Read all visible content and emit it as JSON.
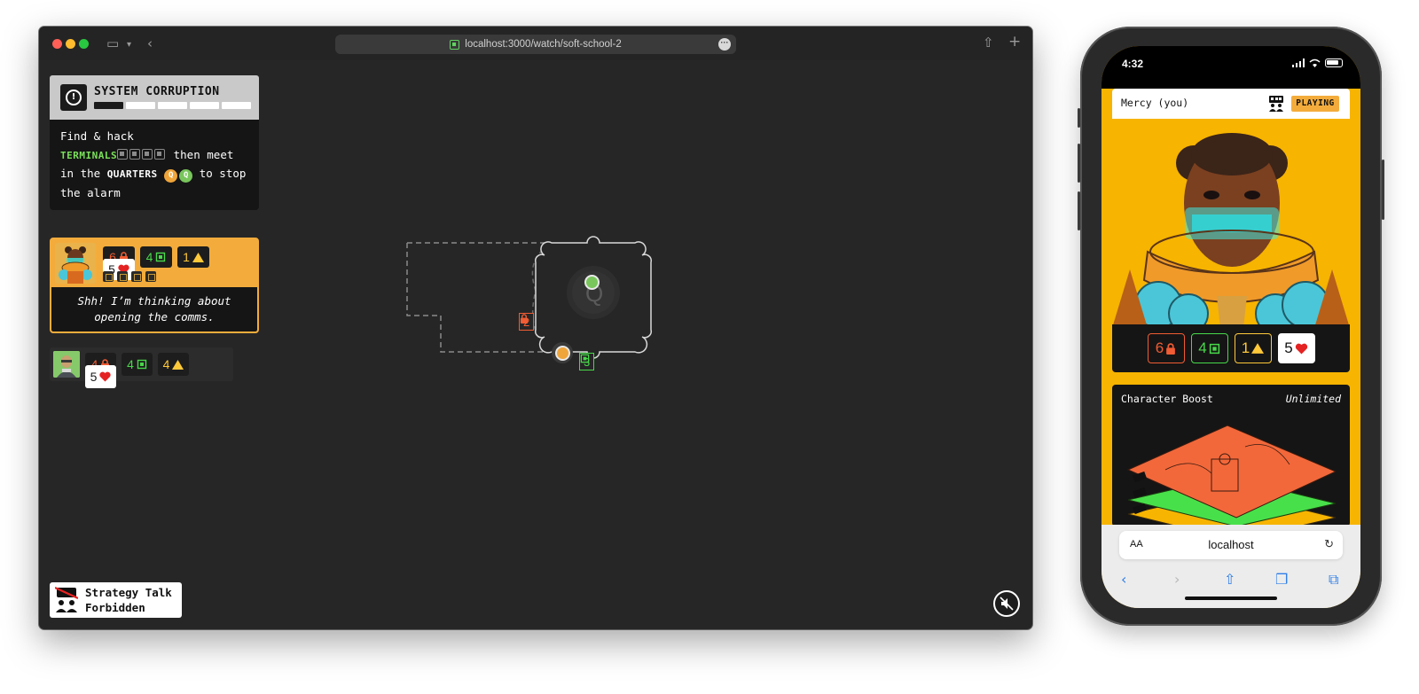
{
  "browser": {
    "url": "localhost:3000/watch/soft-school-2"
  },
  "corruption": {
    "title": "SYSTEM CORRUPTION",
    "level": 1,
    "segments": 5
  },
  "objective": {
    "line1": "Find & hack",
    "terminals": "TERMINALS",
    "then_meet": " then meet",
    "in_the": "in the ",
    "quarters": "QUARTERS",
    "q_letter": "Q",
    "to_stop": " to stop",
    "the_alarm": "the alarm"
  },
  "player_active": {
    "stats": {
      "lock": "6",
      "chip": "4",
      "alert": "1",
      "health": "5"
    },
    "quote": "Shh! I’m thinking about opening the comms."
  },
  "player_other": {
    "stats": {
      "lock": "4",
      "chip": "4",
      "alert": "4",
      "health": "5"
    }
  },
  "map": {
    "room_label": "Q",
    "lock_label": "2",
    "chip_label": "3"
  },
  "strategy": {
    "line1": "Strategy Talk",
    "line2": "Forbidden"
  },
  "phone": {
    "time": "4:32",
    "player_name": "Mercy (you)",
    "status_badge": "PLAYING",
    "stats": {
      "lock": "6",
      "chip": "4",
      "alert": "1",
      "health": "5"
    },
    "boost_title": "Character Boost",
    "boost_tag": "Unlimited",
    "url": "localhost",
    "text_size": "AA"
  },
  "colors": {
    "orange": "#f05c33",
    "green": "#48d84a",
    "yellow": "#ffc93a",
    "red": "#e52222",
    "card_orange": "#f3ac3c"
  }
}
